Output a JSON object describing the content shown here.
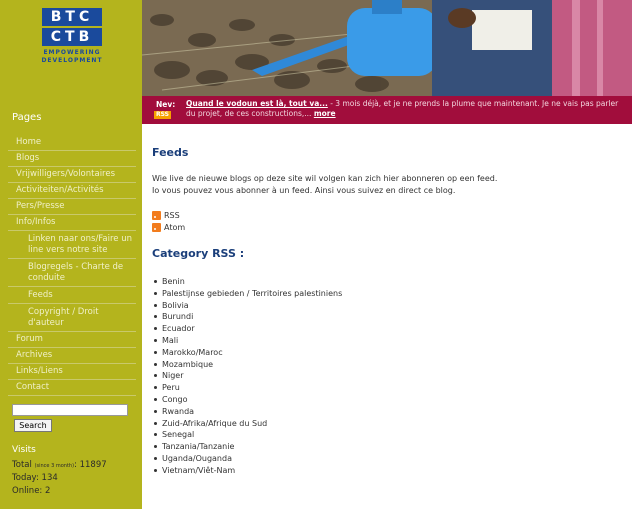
{
  "logo": {
    "line1": "BTC",
    "line2": "CTB",
    "tagline1": "EMPOWERING",
    "tagline2": "DEVELOPMENT"
  },
  "sidebar": {
    "pages_title": "Pages",
    "nav": [
      {
        "label": "Home",
        "sub": false
      },
      {
        "label": "Blogs",
        "sub": false
      },
      {
        "label": "Vrijwilligers/Volontaires",
        "sub": false
      },
      {
        "label": "Activiteiten/Activités",
        "sub": false
      },
      {
        "label": "Pers/Presse",
        "sub": false
      },
      {
        "label": "Info/Infos",
        "sub": false
      },
      {
        "label": "Linken naar ons/Faire un line vers notre site",
        "sub": true
      },
      {
        "label": "Blogregels - Charte de conduite",
        "sub": true
      },
      {
        "label": "Feeds",
        "sub": true
      },
      {
        "label": "Copyright / Droit d'auteur",
        "sub": true
      },
      {
        "label": "Forum",
        "sub": false
      },
      {
        "label": "Archives",
        "sub": false
      },
      {
        "label": "Links/Liens",
        "sub": false
      },
      {
        "label": "Contact",
        "sub": false
      }
    ],
    "search_value": "",
    "search_button": "Search",
    "visits_title": "Visits",
    "total_label": "Total",
    "total_note": "(since 3 month)",
    "total_value": ": 11897",
    "today": "Today: 134",
    "online": "Online: 2"
  },
  "news": {
    "label": "Nev:",
    "rss": "RSS",
    "link": "Quand le vodoun est là, tout va...",
    "text": " - 3 mois déjà, et je ne prends la plume que maintenant. Je ne vais pas parler du projet, de ces constructions,... ",
    "more": "more"
  },
  "main": {
    "feeds_title": "Feeds",
    "intro_nl": "Wie live de nieuwe blogs op deze site wil volgen kan zich hier abonneren op een feed.",
    "intro_fr": "Io vous pouvez vous abonner à un feed. Ainsi vous suivez en direct ce blog.",
    "feed_links": [
      "RSS",
      "Atom"
    ],
    "category_title": "Category RSS :",
    "categories": [
      "Benin",
      "Palestijnse gebieden / Territoires palestiniens",
      "Bolivia",
      "Burundi",
      "Ecuador",
      "Mali",
      "Marokko/Maroc",
      "Mozambique",
      "Niger",
      "Peru",
      "Congo",
      "Rwanda",
      "Zuid-Afrika/Afrique du Sud",
      "Senegal",
      "Tanzania/Tanzanie",
      "Uganda/Ouganda",
      "Vietnam/Viêt-Nam"
    ]
  },
  "colors": {
    "sidebar": "#b4b41d",
    "news_bar": "#a10d3c",
    "heading": "#1a3e7a",
    "logo_blue": "#1a4a9c",
    "rss_orange": "#f27c1d"
  }
}
